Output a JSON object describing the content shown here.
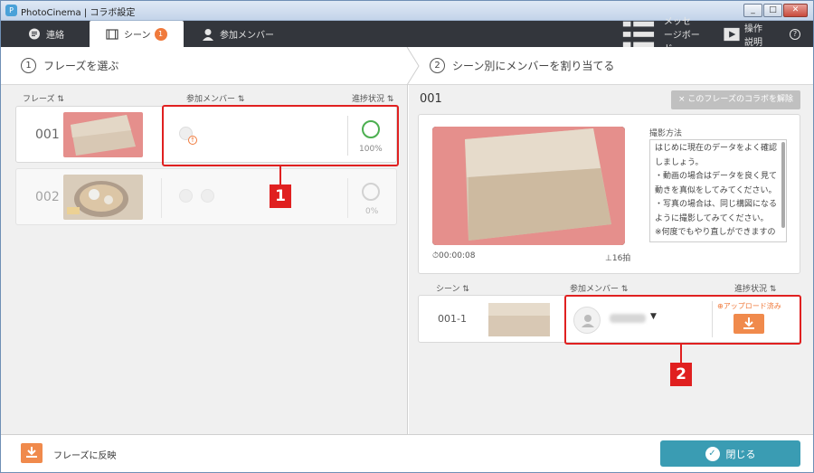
{
  "window": {
    "title": "PhotoCinema | コラボ設定",
    "app_icon": "photocinema-icon"
  },
  "tabs": [
    {
      "label": "連絡",
      "icon": "speech-bubble-icon"
    },
    {
      "label": "シーン",
      "icon": "film-icon",
      "badge": "1",
      "active": true
    },
    {
      "label": "参加メンバー",
      "icon": "person-icon"
    }
  ],
  "toolbar": {
    "message_board": "メッセージボード",
    "howto": "操作説明",
    "help": "?"
  },
  "steps": [
    {
      "num": "1",
      "label": "フレーズを選ぶ"
    },
    {
      "num": "2",
      "label": "シーン別にメンバーを割り当てる"
    }
  ],
  "left": {
    "headers": {
      "phrase": "フレーズ",
      "members": "参加メンバー",
      "progress": "進捗状況"
    },
    "frames": [
      {
        "num": "001",
        "progress_pct": "100%",
        "progress_value": 1.0
      },
      {
        "num": "002",
        "progress_pct": "0%",
        "progress_value": 0.0
      }
    ]
  },
  "right": {
    "frame_title": "001",
    "unlink_label": "× このフレーズのコラボを解除",
    "time": "00:00:08",
    "shots": "16拍",
    "howto_label": "撮影方法",
    "howto_lines": [
      "はじめに現在のデータをよく確認しましょう。",
      "・動画の場合はデータを良く見て動きを真似をしてみてください。",
      "・写真の場合は、同じ構図になるように撮影してみてください。",
      "※何度でもやり直しができますので、気軽にトライしてみてください。"
    ],
    "scene_headers": {
      "scene": "シーン",
      "members": "参加メンバー",
      "progress": "進捗状況"
    },
    "scene": {
      "num": "001-1",
      "status": "アップロード済み"
    }
  },
  "callouts": {
    "one": "1",
    "two": "2"
  },
  "footer": {
    "reflect_label": "フレーズに反映",
    "close_label": "閉じる"
  },
  "colors": {
    "accent": "#f07a3c",
    "highlight": "#e02020",
    "primary": "#3a9cb3",
    "progress": "#4caf50"
  }
}
